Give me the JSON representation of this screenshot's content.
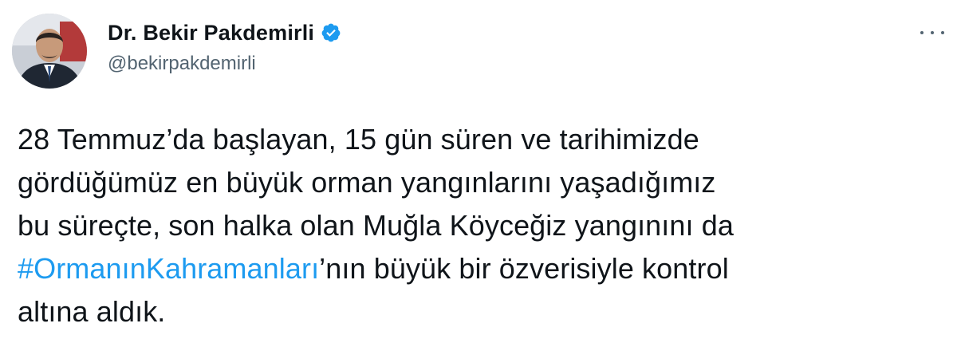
{
  "author": {
    "display_name": "Dr. Bekir Pakdemirli",
    "handle": "@bekirpakdemirli",
    "verified": true,
    "verified_color": "#1d9bf0"
  },
  "menu": {
    "icon": "more-horizontal-icon"
  },
  "tweet": {
    "line1": "28 Temmuz’da başlayan, 15 gün süren ve tarihimizde",
    "line2": "gördüğümüz en büyük orman yangınlarını yaşadığımız",
    "line3": "bu süreçte, son halka olan Muğla Köyceğiz yangınını da",
    "hashtag": "#OrmanınKahramanları",
    "line4_rest": "’nın büyük bir özverisiyle kontrol",
    "line5": "altına aldık.",
    "link_color": "#1d9bf0"
  }
}
